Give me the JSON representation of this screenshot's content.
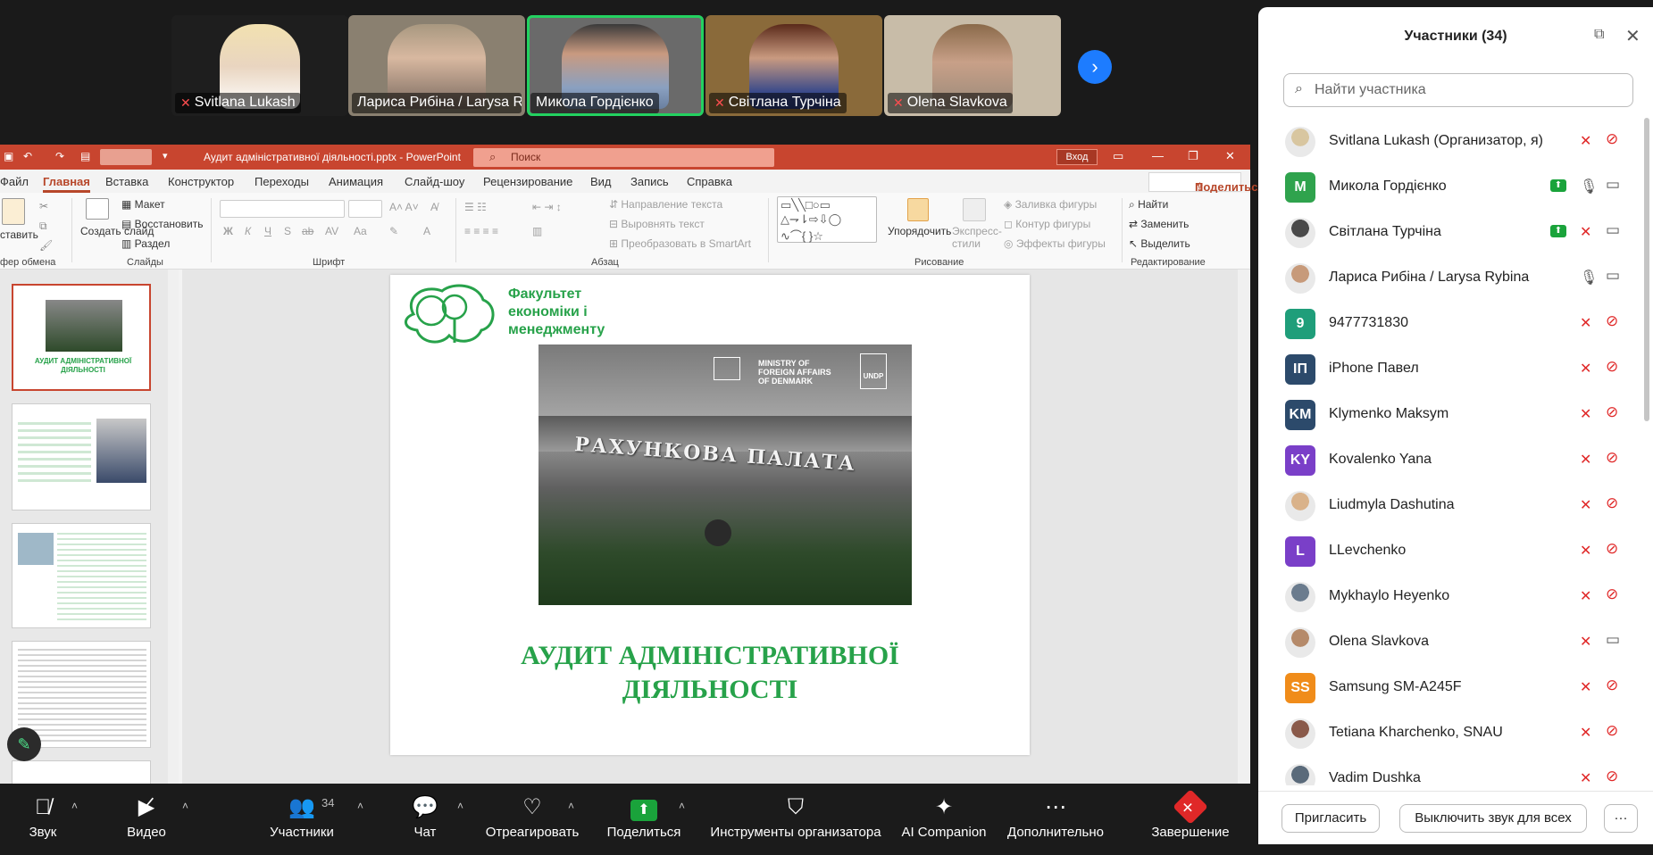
{
  "video": {
    "tiles": [
      {
        "name": "Svitlana Lukash",
        "mic_off": true,
        "active": false
      },
      {
        "name": "Лариса Рибіна / Larysa R...",
        "mic_off": false,
        "active": false
      },
      {
        "name": "Микола Гордієнко",
        "mic_off": false,
        "active": true
      },
      {
        "name": "Світлана Турчіна",
        "mic_off": true,
        "active": false
      },
      {
        "name": "Olena Slavkova",
        "mic_off": true,
        "active": false
      }
    ]
  },
  "ppt": {
    "doc_title": "Аудит адміністративної діяльності.pptx  -  PowerPoint",
    "search_placeholder": "Поиск",
    "login": "Вход",
    "menu": [
      "Файл",
      "Главная",
      "Вставка",
      "Конструктор",
      "Переходы",
      "Анимация",
      "Слайд-шоу",
      "Рецензирование",
      "Вид",
      "Запись",
      "Справка"
    ],
    "share": "Поделиться",
    "ribbon": {
      "paste": "ставить",
      "create_slide": "Создать слайд",
      "layout": "Макет",
      "restore": "Восстановить",
      "section": "Раздел",
      "text_direction": "Направление текста",
      "align_text": "Выровнять текст",
      "smartart": "Преобразовать в SmartArt",
      "arrange": "Упорядочить",
      "express_styles": "Экспресс-стили",
      "fill": "Заливка фигуры",
      "outline": "Контур фигуры",
      "effects": "Эффекты фигуры",
      "find": "Найти",
      "replace": "Заменить",
      "select": "Выделить",
      "groups": {
        "clipboard": "фер обмена",
        "slides": "Слайды",
        "font": "Шрифт",
        "paragraph": "Абзац",
        "drawing": "Рисование",
        "editing": "Редактирование"
      }
    },
    "slide": {
      "faculty": "Факультет економіки і менеджменту",
      "faculty_lines": [
        "Факультет",
        "економіки і",
        "менеджменту"
      ],
      "photo_sign": "РАХУНКОВА ПАЛАТА",
      "mfa_lines": [
        "MINISTRY OF",
        "FOREIGN AFFAIRS",
        "OF DENMARK"
      ],
      "undp": "UNDP",
      "title_lines": [
        "АУДИТ АДМІНІСТРАТИВНОЇ",
        "ДІЯЛЬНОСТІ"
      ]
    },
    "thumb_title": "АУДИТ АДМІНІСТРАТИВНОЇ ДІЯЛЬНОСТІ"
  },
  "panel": {
    "title": "Участники (34)",
    "search_placeholder": "Найти участника",
    "participants": [
      {
        "name": "Svitlana Lukash (Организатор, я)",
        "initials": "",
        "color": "#d8c6a0",
        "mic": "off",
        "cam": "off",
        "share": false
      },
      {
        "name": "Микола Гордієнко",
        "initials": "M",
        "color": "#2fa34d",
        "mic": "on",
        "cam": "on",
        "share": true
      },
      {
        "name": "Світлана Турчіна",
        "initials": "",
        "color": "#4a4a4a",
        "mic": "off",
        "cam": "on",
        "share": true
      },
      {
        "name": "Лариса Рибіна / Larysa Rybina",
        "initials": "",
        "color": "#c79a7a",
        "mic": "on",
        "cam": "on",
        "share": false
      },
      {
        "name": "9477731830",
        "initials": "9",
        "color": "#1f9e7a",
        "mic": "off",
        "cam": "off",
        "share": false
      },
      {
        "name": "iPhone Павел",
        "initials": "IП",
        "color": "#2c4a6b",
        "mic": "off",
        "cam": "off",
        "share": false
      },
      {
        "name": "Klymenko Maksym",
        "initials": "KM",
        "color": "#2c4a6b",
        "mic": "off",
        "cam": "off",
        "share": false
      },
      {
        "name": "Kovalenko Yana",
        "initials": "KY",
        "color": "#7a3fc8",
        "mic": "off",
        "cam": "off",
        "share": false
      },
      {
        "name": "Liudmyla Dashutina",
        "initials": "",
        "color": "#d9b28a",
        "mic": "off",
        "cam": "off",
        "share": false
      },
      {
        "name": "LLevchenko",
        "initials": "L",
        "color": "#7a3fc8",
        "mic": "off",
        "cam": "off",
        "share": false
      },
      {
        "name": "Mykhaylo Heyenko",
        "initials": "",
        "color": "#6b7c8e",
        "mic": "off",
        "cam": "off",
        "share": false
      },
      {
        "name": "Olena Slavkova",
        "initials": "",
        "color": "#b58a6a",
        "mic": "off",
        "cam": "on",
        "share": false
      },
      {
        "name": "Samsung SM-A245F",
        "initials": "SS",
        "color": "#f08c1a",
        "mic": "off",
        "cam": "off",
        "share": false
      },
      {
        "name": "Tetiana Kharchenko, SNAU",
        "initials": "",
        "color": "#8a5a4a",
        "mic": "off",
        "cam": "off",
        "share": false
      },
      {
        "name": "Vadim Dushka",
        "initials": "",
        "color": "#5a6a7a",
        "mic": "off",
        "cam": "off",
        "share": false
      }
    ],
    "invite": "Пригласить",
    "mute_all": "Выключить звук для всех",
    "more": "···"
  },
  "toolbar": {
    "audio": "Звук",
    "video": "Видео",
    "participants": "Участники",
    "participants_count": "34",
    "chat": "Чат",
    "react": "Отреагировать",
    "share": "Поделиться",
    "host_tools": "Инструменты организатора",
    "ai": "AI Companion",
    "more": "Дополнительно",
    "end": "Завершение"
  }
}
